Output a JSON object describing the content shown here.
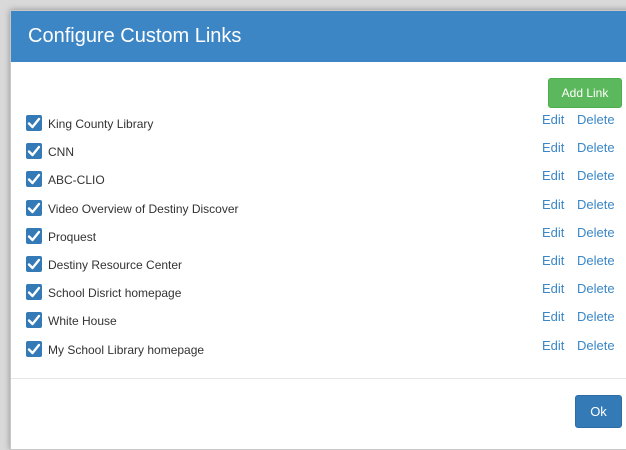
{
  "dialog": {
    "title": "Configure Custom Links",
    "add_link_label": "Add Link",
    "ok_label": "Ok",
    "accent_color": "#3d86c6",
    "add_button_color": "#5cb85c"
  },
  "links": {
    "edit_label": "Edit",
    "delete_label": "Delete",
    "items": [
      {
        "label": "King County Library",
        "checked": true
      },
      {
        "label": "CNN",
        "checked": true
      },
      {
        "label": "ABC-CLIO",
        "checked": true
      },
      {
        "label": "Video Overview of Destiny Discover",
        "checked": true
      },
      {
        "label": "Proquest",
        "checked": true
      },
      {
        "label": "Destiny Resource Center",
        "checked": true
      },
      {
        "label": "School Disrict homepage",
        "checked": true
      },
      {
        "label": "White House",
        "checked": true
      },
      {
        "label": "My School Library homepage",
        "checked": true
      }
    ]
  }
}
